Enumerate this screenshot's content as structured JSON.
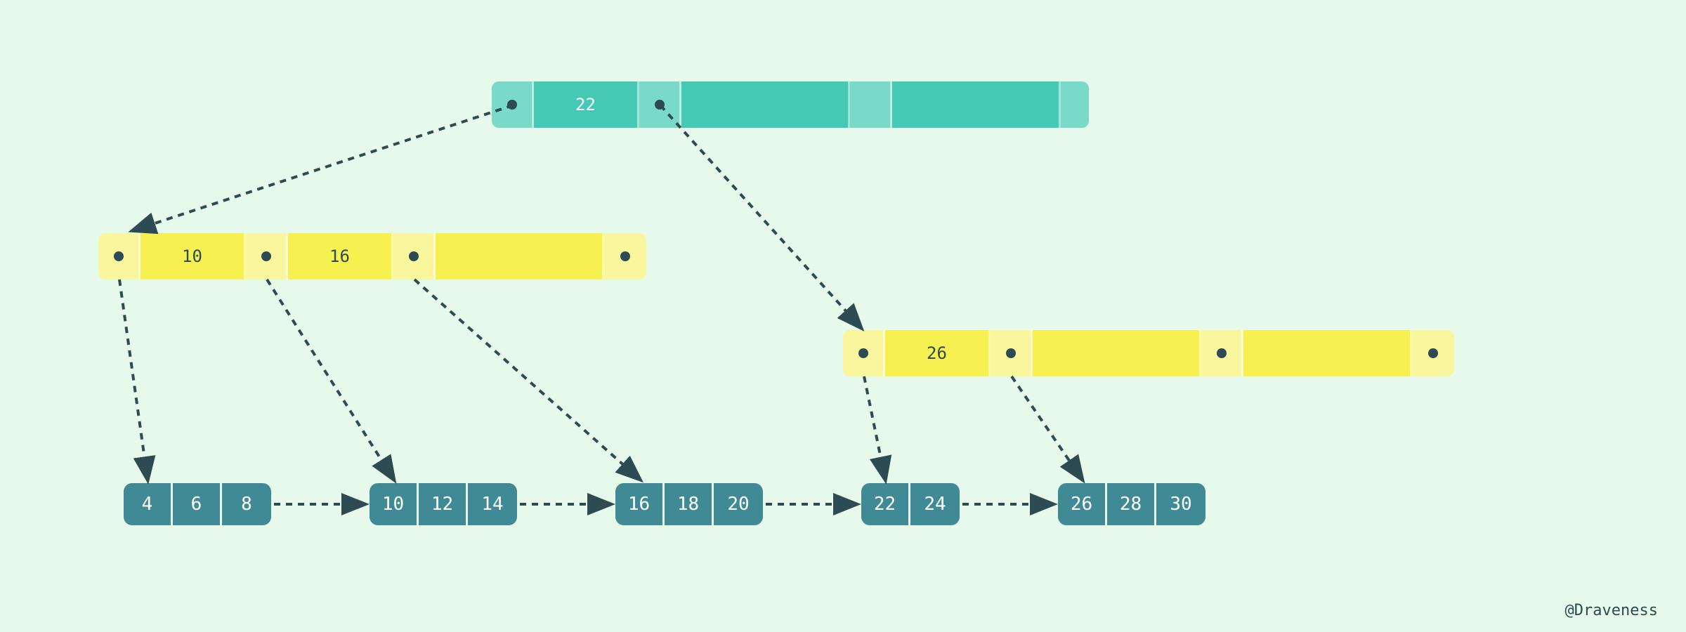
{
  "attribution": "@Draveness",
  "colors": {
    "background": "#e7f9ea",
    "root_fill": "#46c9b4",
    "root_ptr": "#79dac9",
    "internal_fill": "#f6f050",
    "internal_ptr": "#faf69e",
    "leaf_fill": "#408a96",
    "arrow": "#2e4a52"
  },
  "tree": {
    "root": {
      "keys": [
        "22",
        "",
        ""
      ],
      "pointers": 4
    },
    "internal_left": {
      "keys": [
        "10",
        "16",
        ""
      ],
      "pointers": 4
    },
    "internal_right": {
      "keys": [
        "26",
        "",
        ""
      ],
      "pointers": 4
    },
    "leaves": [
      {
        "values": [
          "4",
          "6",
          "8"
        ]
      },
      {
        "values": [
          "10",
          "12",
          "14"
        ]
      },
      {
        "values": [
          "16",
          "18",
          "20"
        ]
      },
      {
        "values": [
          "22",
          "24"
        ]
      },
      {
        "values": [
          "26",
          "28",
          "30"
        ]
      }
    ]
  }
}
